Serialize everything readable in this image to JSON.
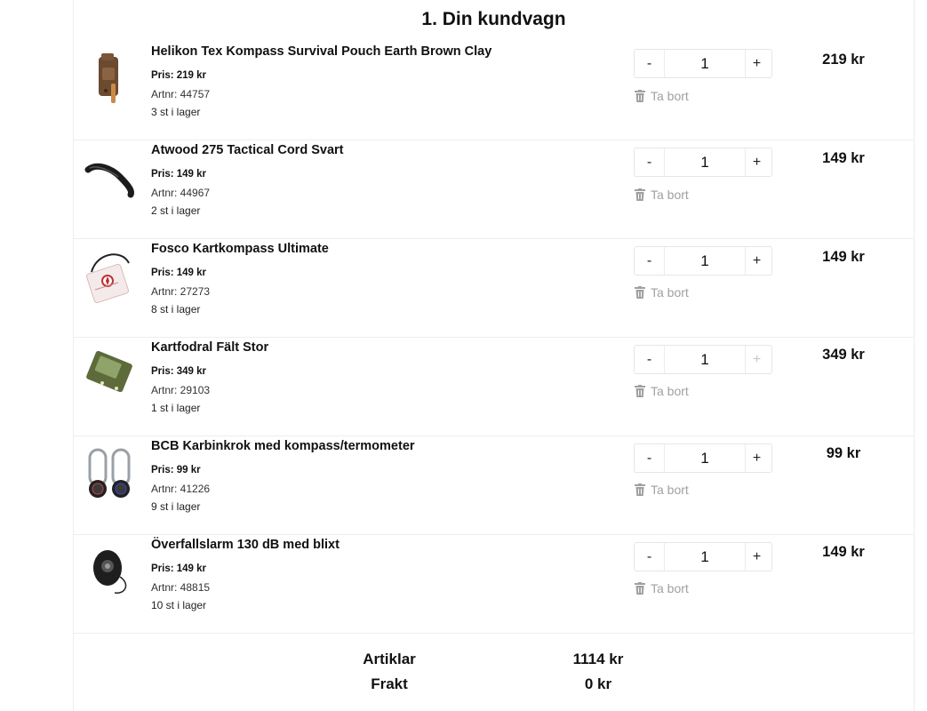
{
  "cart": {
    "title": "1. Din kundvagn",
    "remove_label": "Ta bort",
    "items": [
      {
        "name": "Helikon Tex Kompass Survival Pouch Earth Brown Clay",
        "price": "Pris: 219 kr",
        "artnr": "Artnr: 44757",
        "stock": "3 st i lager",
        "quantity": "1",
        "total": "219 kr",
        "image": "brown-pouch"
      },
      {
        "name": "Atwood 275 Tactical Cord Svart",
        "price": "Pris: 149 kr",
        "artnr": "Artnr: 44967",
        "stock": "2 st i lager",
        "quantity": "1",
        "total": "149 kr",
        "image": "black-cord"
      },
      {
        "name": "Fosco Kartkompass Ultimate",
        "price": "Pris: 149 kr",
        "artnr": "Artnr: 27273",
        "stock": "8 st i lager",
        "quantity": "1",
        "total": "149 kr",
        "image": "map-compass"
      },
      {
        "name": "Kartfodral Fält Stor",
        "price": "Pris: 349 kr",
        "artnr": "Artnr: 29103",
        "stock": "1 st i lager",
        "quantity": "1",
        "total": "349 kr",
        "image": "map-case",
        "plus_disabled": true
      },
      {
        "name": "BCB Karbinkrok med kompass/termometer",
        "price": "Pris: 99 kr",
        "artnr": "Artnr: 41226",
        "stock": "9 st i lager",
        "quantity": "1",
        "total": "99 kr",
        "image": "carabiners"
      },
      {
        "name": "Överfallslarm 130 dB med blixt",
        "price": "Pris: 149 kr",
        "artnr": "Artnr: 48815",
        "stock": "10 st i lager",
        "quantity": "1",
        "total": "149 kr",
        "image": "alarm"
      }
    ]
  },
  "qty_controls": {
    "minus": "-",
    "plus": "+"
  },
  "summary": {
    "articles_label": "Artiklar",
    "articles_value": "1114 kr",
    "shipping_label": "Frakt",
    "shipping_value": "0 kr"
  }
}
